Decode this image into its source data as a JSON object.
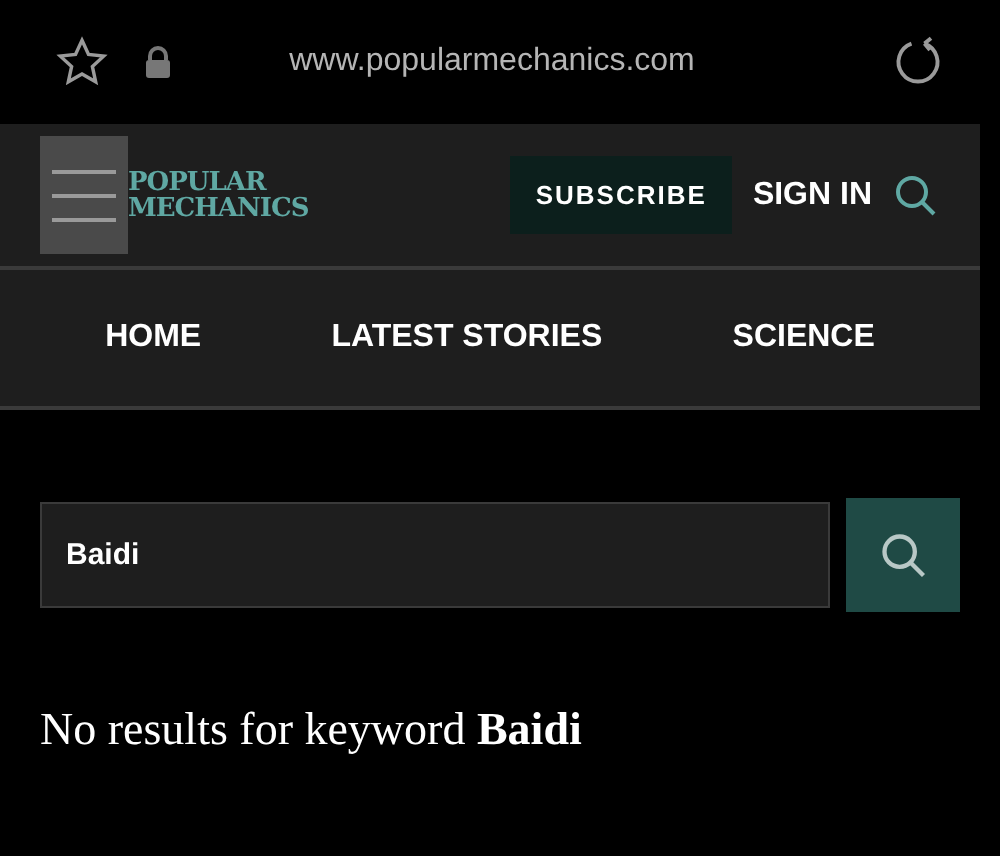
{
  "browser": {
    "url": "www.popularmechanics.com"
  },
  "header": {
    "logo_lines": [
      "POPULAR",
      "MECHANICS"
    ],
    "subscribe": "SUBSCRIBE",
    "sign_in": "SIGN IN"
  },
  "nav": [
    {
      "label": "HOME"
    },
    {
      "label": "LATEST STORIES"
    },
    {
      "label": "SCIENCE"
    }
  ],
  "search": {
    "value": "Baidi"
  },
  "message": "No results for keyword **Baidi**"
}
